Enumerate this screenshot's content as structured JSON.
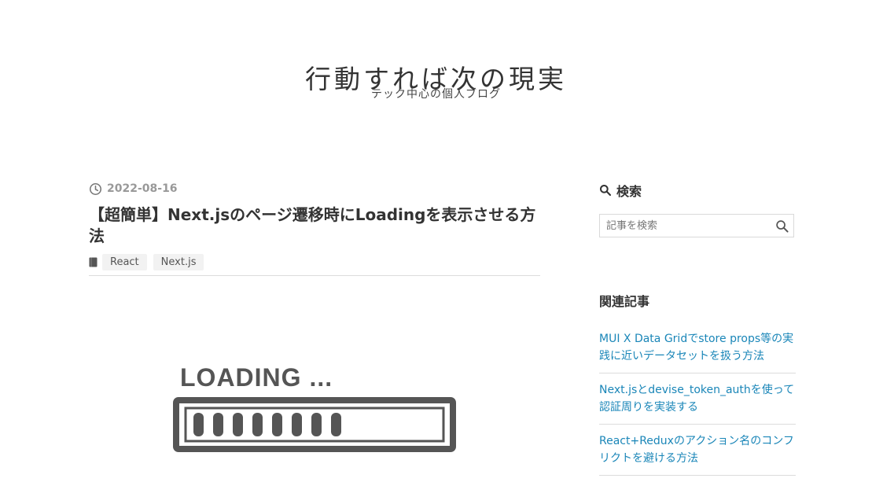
{
  "header": {
    "blog_title": "行動すれば次の現実",
    "blog_description": "テック中心の個人ブログ"
  },
  "entry": {
    "date": "2022-08-16",
    "title": "【超簡単】Next.jsのページ遷移時にLoadingを表示させる方法",
    "categories": [
      "React",
      "Next.js"
    ],
    "image": {
      "loading_text": "LOADING ...",
      "progress_segments_filled": 8
    }
  },
  "sidebar": {
    "search_heading": "検索",
    "search_placeholder": "記事を検索",
    "related_heading": "関連記事",
    "related": [
      "MUI X Data Gridでstore props等の実践に近いデータセットを扱う方法",
      "Next.jsとdevise_token_authを使って認証周りを実装する",
      "React+Reduxのアクション名のコンフリクトを避ける方法"
    ]
  },
  "colors": {
    "link": "#1a86b8",
    "date": "#999999",
    "loading_gray": "#555555"
  }
}
